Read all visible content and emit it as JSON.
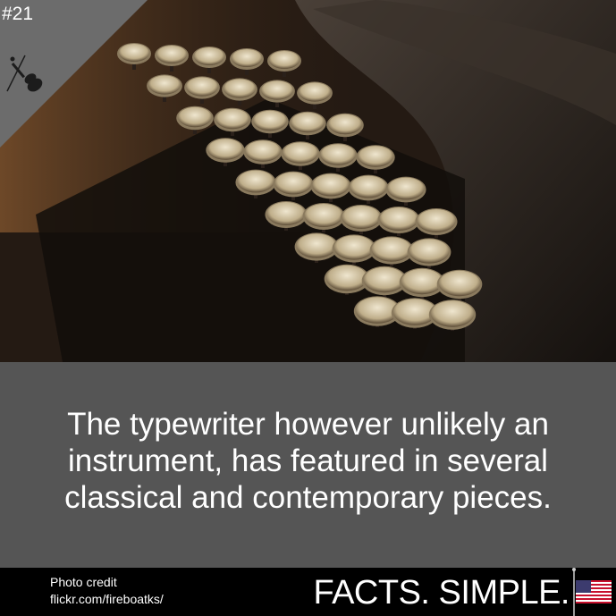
{
  "badge": {
    "number": "#21",
    "icon": "violin-icon"
  },
  "fact": {
    "text": "The typewriter however unlikely an instrument, has featured in several classical and contemporary pieces."
  },
  "footer": {
    "credit_label": "Photo credit",
    "credit_source": "flickr.com/fireboatks/",
    "brand": "FACTS. SIMPLE.",
    "flag_icon": "us-flag-icon"
  },
  "colors": {
    "badge": "#6c6c6c",
    "fact_panel": "#555555",
    "footer": "#000000",
    "text": "#ffffff"
  }
}
